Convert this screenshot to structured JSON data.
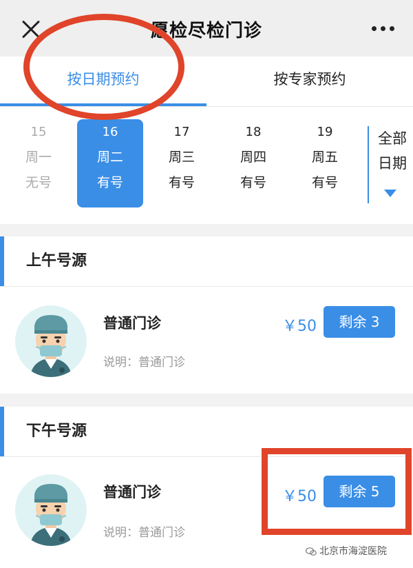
{
  "header": {
    "title": "愿检尽检门诊"
  },
  "tabs": [
    {
      "label": "按日期预约",
      "active": true
    },
    {
      "label": "按专家预约",
      "active": false
    }
  ],
  "dates": [
    {
      "day": "15",
      "weekday": "周一",
      "status": "无号",
      "state": "disabled"
    },
    {
      "day": "16",
      "weekday": "周二",
      "status": "有号",
      "state": "selected"
    },
    {
      "day": "17",
      "weekday": "周三",
      "status": "有号",
      "state": "normal"
    },
    {
      "day": "18",
      "weekday": "周四",
      "status": "有号",
      "state": "normal"
    },
    {
      "day": "19",
      "weekday": "周五",
      "status": "有号",
      "state": "normal"
    }
  ],
  "all_dates": {
    "line1": "全部",
    "line2": "日期"
  },
  "sections": [
    {
      "title": "上午号源",
      "clinic": {
        "name": "普通门诊",
        "note": "说明：普通门诊",
        "price": "￥50",
        "remaining": "剩余 3"
      }
    },
    {
      "title": "下午号源",
      "clinic": {
        "name": "普通门诊",
        "note": "说明：普通门诊",
        "price": "￥50",
        "remaining": "剩余 5"
      }
    }
  ],
  "watermark": {
    "text": "北京市海淀医院"
  },
  "colors": {
    "accent": "#3a8ee6",
    "annotation": "#e0442a",
    "avatar_bg": "#dff3f4"
  }
}
